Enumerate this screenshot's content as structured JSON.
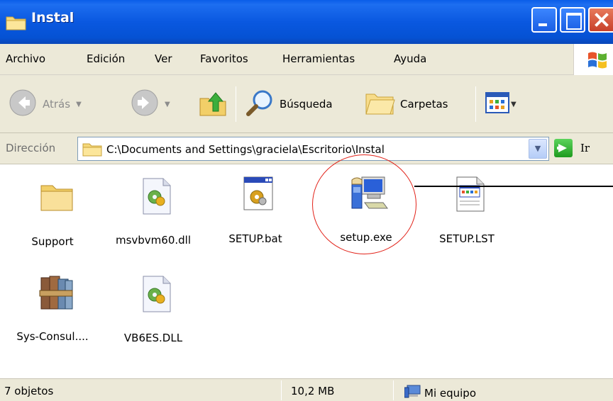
{
  "window": {
    "title": "Instal"
  },
  "menu": [
    "Archivo",
    "Edición",
    "Ver",
    "Favoritos",
    "Herramientas",
    "Ayuda"
  ],
  "toolbar": {
    "back_label": "Atrás",
    "search_label": "Búsqueda",
    "folders_label": "Carpetas"
  },
  "address": {
    "label": "Dirección",
    "path": "C:\\Documents and Settings\\graciela\\Escritorio\\Instal",
    "go_label": "Ir"
  },
  "files": [
    {
      "name": "Support",
      "icon": "folder-icon"
    },
    {
      "name": "msvbvm60.dll",
      "icon": "dll-file-icon"
    },
    {
      "name": "SETUP.bat",
      "icon": "batch-file-icon"
    },
    {
      "name": "setup.exe",
      "icon": "setup-program-icon"
    },
    {
      "name": "SETUP.LST",
      "icon": "lst-file-icon"
    },
    {
      "name": "Sys-Consul....",
      "icon": "winrar-archive-icon"
    },
    {
      "name": "VB6ES.DLL",
      "icon": "dll-file-icon"
    }
  ],
  "status": {
    "objects": "7 objetos",
    "size": "10,2 MB",
    "location": "Mi equipo"
  },
  "colors": {
    "titlebar": "#0a58e0",
    "chrome": "#ece9d8",
    "highlight_circle": "#e2231a"
  }
}
